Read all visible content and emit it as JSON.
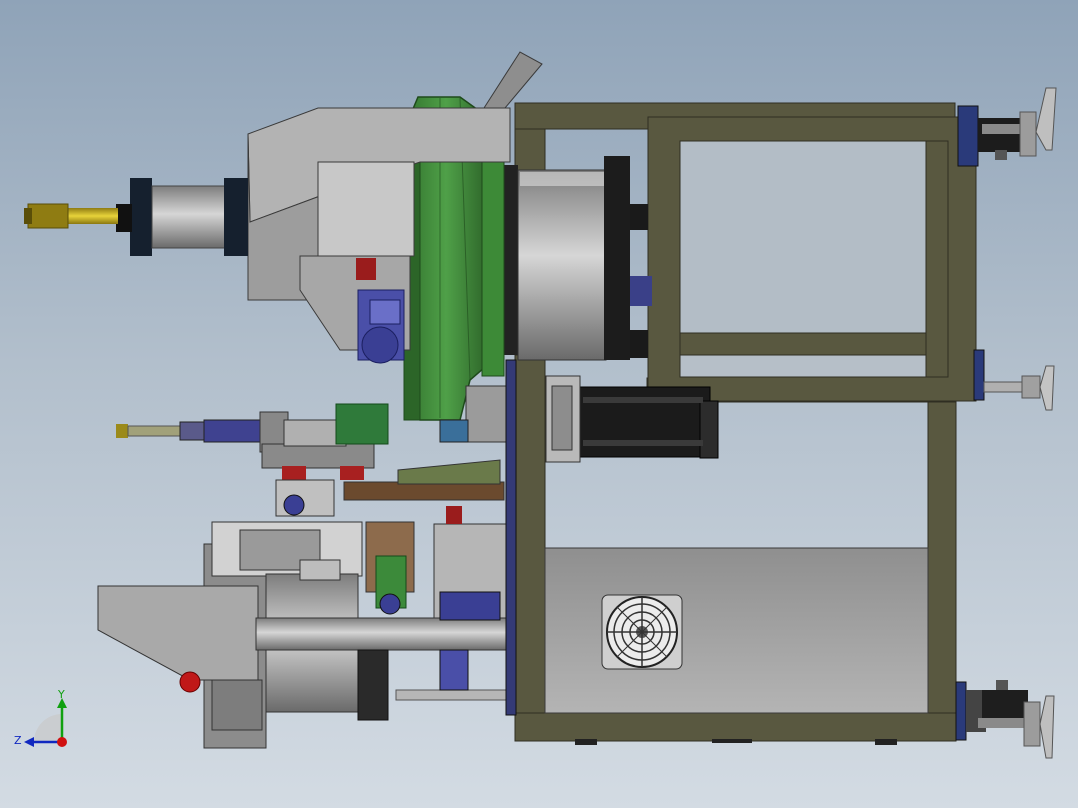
{
  "viewport": {
    "background_top": "#8fa3b8",
    "background_bottom": "#d3dbe3"
  },
  "colors": {
    "frame": "#595840",
    "frame_edge": "#2f2e22",
    "steel": "#a5a5a5",
    "steel_dark": "#6e6e6e",
    "drum_green": "#3f8a3a",
    "drum_green_dark": "#23531f",
    "motor_black": "#1e1e1e",
    "fan_grey": "#e0e0e0",
    "brass": "#c9b01e",
    "blue_part": "#4a4fa8",
    "red_part": "#b32424",
    "foot_grey": "#9a9a9a",
    "axis_y": "#10a010",
    "axis_z": "#1028c0",
    "axis_origin": "#d01010"
  },
  "triad": {
    "y_label": "Y",
    "z_label": "Z"
  }
}
